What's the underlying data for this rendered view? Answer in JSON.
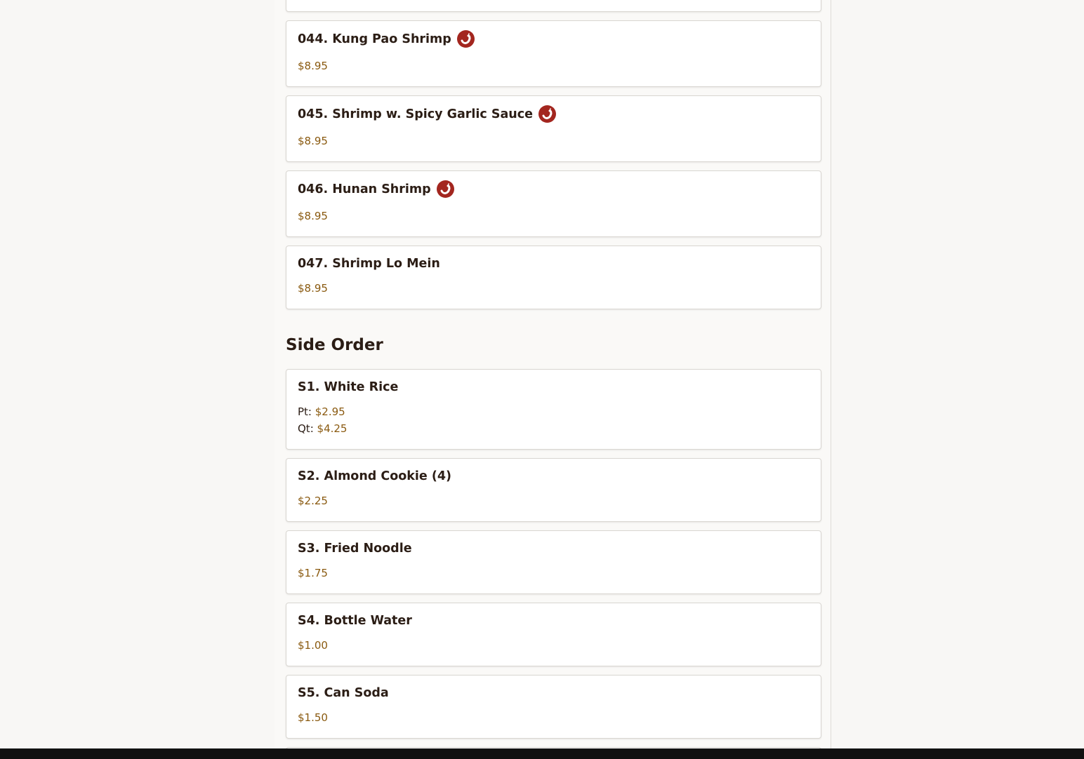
{
  "menu": {
    "items_top": [
      {
        "title": "044. Kung Pao Shrimp",
        "spicy": true,
        "price": "$8.95"
      },
      {
        "title": "045. Shrimp w. Spicy Garlic Sauce",
        "spicy": true,
        "price": "$8.95"
      },
      {
        "title": "046. Hunan Shrimp",
        "spicy": true,
        "price": "$8.95"
      },
      {
        "title": "047. Shrimp Lo Mein",
        "spicy": false,
        "price": "$8.95"
      }
    ],
    "side_order": {
      "heading": "Side Order",
      "items": [
        {
          "title": "S1. White Rice",
          "prices": [
            {
              "label": "Pt:",
              "price": "$2.95"
            },
            {
              "label": "Qt:",
              "price": "$4.25"
            }
          ]
        },
        {
          "title": "S2. Almond Cookie (4)",
          "price": "$2.25"
        },
        {
          "title": "S3. Fried Noodle",
          "price": "$1.75"
        },
        {
          "title": "S4. Bottle Water",
          "price": "$1.00"
        },
        {
          "title": "S5. Can Soda",
          "price": "$1.50"
        }
      ]
    }
  },
  "icons": {
    "spicy": "chili-pepper-icon"
  },
  "colors": {
    "spicy_badge": "#a3261f",
    "price": "#8a5a10",
    "text": "#2b1d15"
  }
}
